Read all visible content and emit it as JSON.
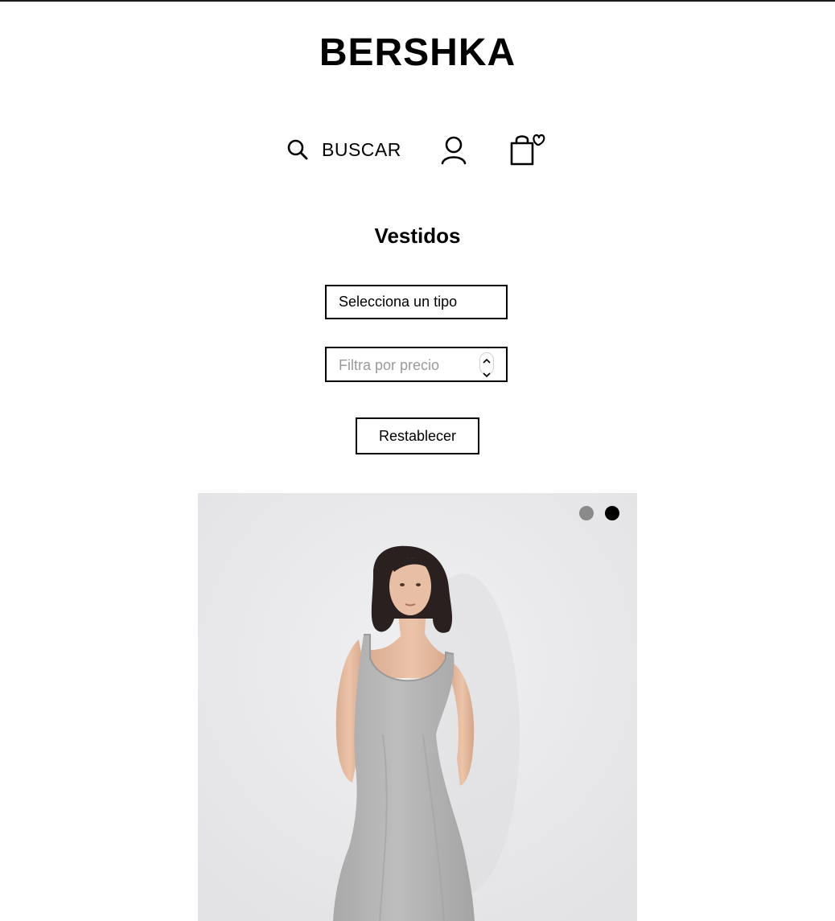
{
  "header": {
    "logo": "BERSHKA",
    "search_label": "BUSCAR",
    "icons": [
      "search-icon",
      "user-icon",
      "shopping-bag-heart-icon"
    ]
  },
  "main": {
    "title": "Vestidos",
    "type_select": {
      "value": "Selecciona un tipo"
    },
    "price_filter": {
      "placeholder": "Filtra por precio"
    },
    "reset_label": "Restablecer"
  },
  "product": {
    "image_slides": 2,
    "active_slide": 2,
    "dress_color": "#b3b3b3"
  }
}
